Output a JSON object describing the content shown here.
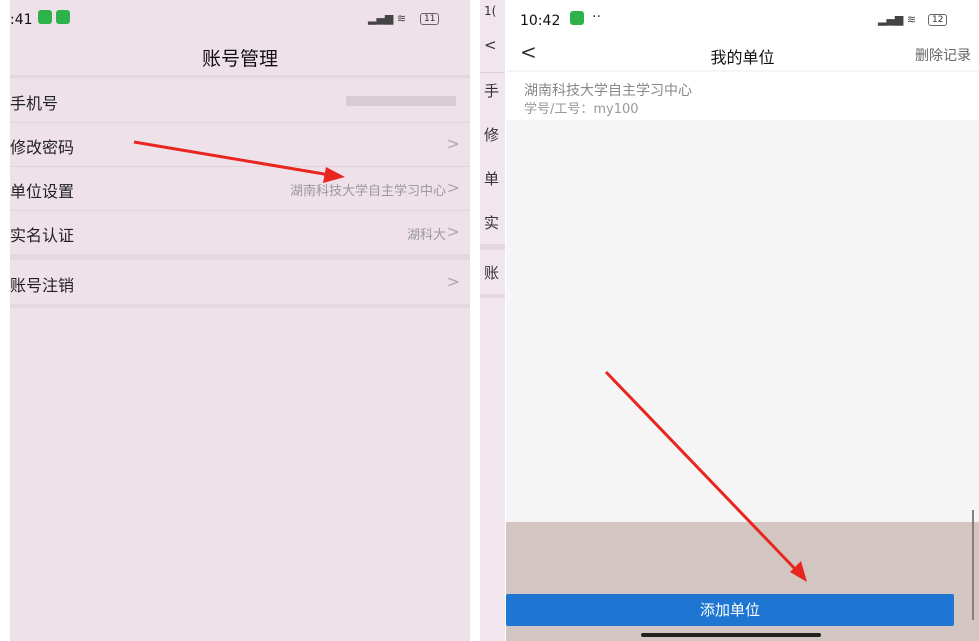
{
  "left": {
    "status": {
      "time": ":41",
      "battery": "11"
    },
    "title": "账号管理",
    "rows": [
      {
        "label": "手机号",
        "value": ""
      },
      {
        "label": "修改密码",
        "value": ""
      },
      {
        "label": "单位设置",
        "value": "湖南科技大学自主学习中心"
      },
      {
        "label": "实名认证",
        "value": "湖科大"
      },
      {
        "label": "账号注销",
        "value": ""
      }
    ],
    "chevron": ">"
  },
  "middle": {
    "chars": [
      "1(",
      "<",
      "手",
      "修",
      "单",
      "实",
      "账"
    ]
  },
  "right": {
    "status": {
      "time": "10:42",
      "dots": "··",
      "battery": "12"
    },
    "back": "<",
    "title": "我的单位",
    "delete_label": "删除记录",
    "unit_name": "湖南科技大学自主学习中心",
    "unit_id": "学号/工号：my100",
    "add_button": "添加单位"
  },
  "colors": {
    "arrow": "#e8261f",
    "button": "#1f76d2",
    "left_bg": "#efe1ea"
  }
}
